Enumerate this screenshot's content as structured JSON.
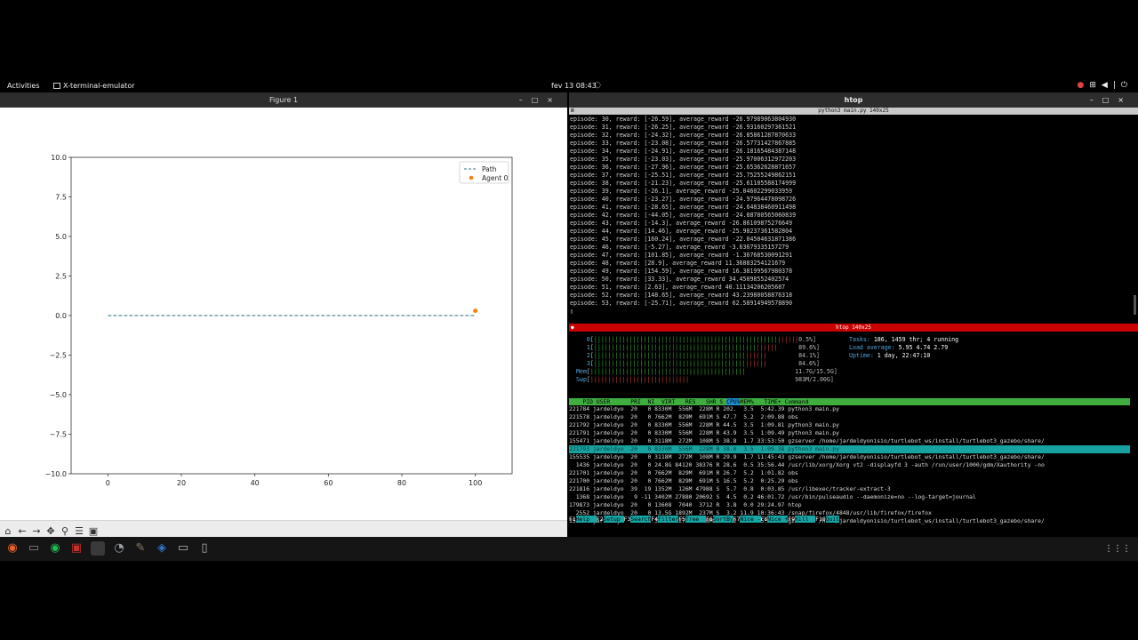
{
  "topbar": {
    "activities": "Activities",
    "app_name": "X-terminal-emulator",
    "clock": "fev 13  08:43",
    "bell_icon": "notification-bell-icon",
    "tray_icons": [
      "record-icon",
      "network-icon",
      "volume-icon",
      "microphone-icon",
      "power-icon"
    ]
  },
  "figure": {
    "title": "Figure 1",
    "window_controls": [
      "–",
      "□",
      "×"
    ],
    "toolbar_icons": [
      "home-icon",
      "back-icon",
      "forward-icon",
      "pan-icon",
      "zoom-icon",
      "configure-icon",
      "save-icon"
    ]
  },
  "chart_data": {
    "type": "line",
    "title": "",
    "xlabel": "",
    "ylabel": "",
    "xlim": [
      -10,
      110
    ],
    "ylim": [
      -10,
      10
    ],
    "xticks": [
      "0",
      "20",
      "40",
      "60",
      "80",
      "100"
    ],
    "yticks": [
      "10.0",
      "7.5",
      "5.0",
      "2.5",
      "0.0",
      "−2.5",
      "−5.0",
      "−7.5",
      "−10.0"
    ],
    "grid": false,
    "legend_position": "top-right",
    "series": [
      {
        "name": "Path",
        "style": "dashed-line",
        "color": "#2f6f7f",
        "x": [
          0,
          100
        ],
        "y": [
          0,
          0
        ]
      },
      {
        "name": "Agent 0",
        "style": "marker",
        "color": "#ff7f0e",
        "x": [
          100
        ],
        "y": [
          0.3
        ]
      }
    ]
  },
  "terminal": {
    "title": "htop",
    "pane1_title": "python3 main.py 140x25",
    "pane2_title": "htop 140x25",
    "log_lines": [
      "episode: 30, reward: [-26.59], average_reward -26.97989063804930",
      "episode: 31, reward: [-26.25], average_reward -26.93160297361521",
      "episode: 32, reward: [-24.32], average_reward -26.85861287870633",
      "episode: 33, reward: [-23.08], average_reward -26.57731427867885",
      "episode: 34, reward: [-24.91], average_reward -26.18165484387148",
      "episode: 35, reward: [-23.03], average_reward -25.97006312972203",
      "episode: 36, reward: [-27.96], average_reward -25.65362628871657",
      "episode: 37, reward: [-25.51], average_reward -25.75255249862151",
      "episode: 38, reward: [-21.23], average_reward -25.61105588174999",
      "episode: 39, reward: [-26.1], average_reward -25.04602299033959",
      "episode: 40, reward: [-23.27], average_reward -24.97964478098726",
      "episode: 41, reward: [-28.65], average_reward -24.64838460911498",
      "episode: 42, reward: [-44.05], average_reward -24.88780565060839",
      "episode: 43, reward: [-14.3], average_reward -26.86109875276649",
      "episode: 44, reward: [14.46], average_reward -25.98237361582804",
      "episode: 45, reward: [160.24], average_reward -22.04504631871386",
      "episode: 46, reward: [-5.27], average_reward -3.63679335157279",
      "episode: 47, reward: [101.85], average_reward -1.36768530091291",
      "episode: 48, reward: [28.9], average_reward 11.36883254121679",
      "episode: 49, reward: [154.59], average_reward 16.38199567980378",
      "episode: 50, reward: [33.33], average_reward 34.45098552402574",
      "episode: 51, reward: [2.63], average_reward 40.11134206205687",
      "episode: 52, reward: [148.65], average_reward 43.23980058876318",
      "episode: 53, reward: [-25.71], average_reward 62.58914949578890"
    ],
    "cursor": "▯"
  },
  "htop": {
    "cpu_meters": [
      {
        "id": "0",
        "value": "0.5%",
        "fill": 1.0
      },
      {
        "id": "1",
        "value": "89.6%",
        "fill": 0.9
      },
      {
        "id": "2",
        "value": "84.1%",
        "fill": 0.84
      },
      {
        "id": "3",
        "value": "84.6%",
        "fill": 0.85
      }
    ],
    "mem": {
      "label": "Mem",
      "value": "11.7G/15.5G",
      "fill": 0.75
    },
    "swp": {
      "label": "Swp",
      "value": "983M/2.00G",
      "fill": 0.48
    },
    "tasks_label": "Tasks:",
    "tasks_value": "186, 1459 thr; 4 running",
    "load_label": "Load average:",
    "load_value": "5.95 4.74 2.79",
    "uptime_label": "Uptime:",
    "uptime_value": "1 day, 22:47:10",
    "header_cols": [
      "PID",
      "USER",
      "PRI",
      "NI",
      "VIRT",
      "RES",
      "SHR",
      "S",
      "CPU%",
      "MEM%",
      "TIME+",
      "Command"
    ],
    "processes": [
      "221784 jardeldyo  20   0 8330M  556M  228M R 202.  3.5  5:42.39 python3 main.py",
      "221578 jardeldyo  20   0 7662M  829M  691M S 47.7  5.2  2:09.88 obs",
      "221792 jardeldyo  20   0 8330M  556M  228M R 44.5  3.5  1:09.81 python3 main.py",
      "221791 jardeldyo  20   0 8330M  556M  228M R 43.9  3.5  1:09.49 python3 main.py",
      "155471 jardeldyo  20   0 3118M  272M  108M S 38.8  1.7 33:53:50 gzserver /home/jardeldyonisio/turtlebot_ws/install/turtlebot3_gazebo/share/",
      "221793 jardeldyo  20   0 8330M  556M  228M R 38.0  3.5  1:09.38 python3 main.py",
      "155535 jardeldyo  20   0 3118M  272M  108M R 29.9  1.7 11:45:43 gzserver /home/jardeldyonisio/turtlebot_ws/install/turtlebot3_gazebo/share/",
      "  1436 jardeldyo  20   0 24.8G 84120 38376 R 28.6  0.5 35:56.44 /usr/lib/xorg/Xorg vt2 -displayfd 3 -auth /run/user/1000/gdm/Xauthority -no",
      "221701 jardeldyo  20   0 7662M  829M  691M R 26.7  5.2  1:01.82 obs",
      "221700 jardeldyo  20   0 7662M  829M  691M S 16.5  5.2  0:25.29 obs",
      "221816 jardeldyo  39  19 1352M  126M 47988 S  5.7  0.8  0:03.85 /usr/libexec/tracker-extract-3",
      "  1368 jardeldyo   9 -11 3402M 27880 20692 S  4.5  0.2 46:01.72 /usr/bin/pulseaudio --daemonize=no --log-target=journal",
      "179873 jardeldyo  20   0 13608  7040  3712 R  3.8  0.0 29:24.97 htop",
      "  2552 jardeldyo  20   0 13.5G 1892M  237M S  3.2 11.9 10:36:43 /snap/firefox/4848/usr/lib/firefox/firefox",
      "155502 jardeldyo  20   0 3118M  272M  108M S  3.2  1.7 55:59.76 gzserver /home/jardeldyonisio/turtlebot_ws/install/turtlebot3_gazebo/share/"
    ],
    "fkeys": [
      {
        "k": "F1",
        "l": "Help  "
      },
      {
        "k": "F2",
        "l": "Setup "
      },
      {
        "k": "F3",
        "l": "Search"
      },
      {
        "k": "F4",
        "l": "Filter"
      },
      {
        "k": "F5",
        "l": "Tree  "
      },
      {
        "k": "F6",
        "l": "SortBy"
      },
      {
        "k": "F7",
        "l": "Nice -"
      },
      {
        "k": "F8",
        "l": "Nice +"
      },
      {
        "k": "F9",
        "l": "Kill  "
      },
      {
        "k": "F10",
        "l": "Quit"
      }
    ]
  },
  "dock": {
    "icons": [
      "firefox-icon",
      "files-icon",
      "spotify-icon",
      "obs-icon",
      "terminal-icon",
      "system-monitor-icon",
      "gimp-icon",
      "vscode-icon",
      "disk-icon",
      "trash-icon"
    ],
    "apps_grid_icon": "show-applications-icon"
  }
}
